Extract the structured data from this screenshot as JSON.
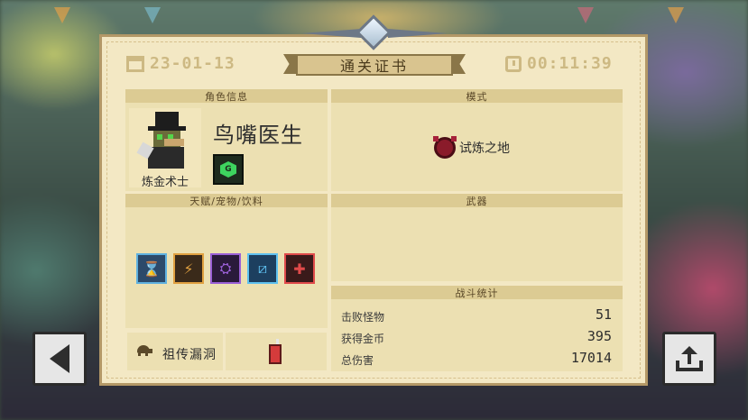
{
  "header": {
    "date": "23-01-13",
    "title": "通关证书",
    "time": "00:11:39"
  },
  "sections": {
    "character_info": "角色信息",
    "mode": "模式",
    "talents_pets_drinks": "天赋/宠物/饮料",
    "weapons": "武器",
    "battle_stats": "战斗统计"
  },
  "character": {
    "name": "鸟嘴医生",
    "class": "炼金术士",
    "skill_icon": "green-hex-skill-icon"
  },
  "mode": {
    "label": "试炼之地",
    "icon": "red-horned-mask-icon"
  },
  "talents": [
    {
      "icon": "hourglass-icon",
      "glyph": "⌛",
      "bg": "#2c4a6a",
      "border": "#5fb1e0"
    },
    {
      "icon": "lightning-bolts-icon",
      "glyph": "⚡",
      "bg": "#3a2a1a",
      "border": "#e0a040"
    },
    {
      "icon": "purple-wizard-hat-icon",
      "glyph": "⛭",
      "bg": "#2a1a3a",
      "border": "#9a5fd6"
    },
    {
      "icon": "blue-diagonal-stripe-icon",
      "glyph": "⧄",
      "bg": "#1d3f5f",
      "border": "#5fc1f0"
    },
    {
      "icon": "red-heart-plus-icon",
      "glyph": "✚",
      "bg": "#3a1a1a",
      "border": "#e04a4a"
    }
  ],
  "pet": {
    "name": "祖传漏洞",
    "icon": "turtle-icon"
  },
  "drink": {
    "icon": "red-soda-cup-icon"
  },
  "stats": [
    {
      "label": "击败怪物",
      "value": "51"
    },
    {
      "label": "获得金币",
      "value": "395"
    },
    {
      "label": "总伤害",
      "value": "17014"
    }
  ],
  "buttons": {
    "back_icon": "back-arrow-icon",
    "share_icon": "share-icon"
  },
  "colors": {
    "panel_bg": "#f3e8c4",
    "section_bg": "#ece0b2",
    "section_header": "#dccb93",
    "ribbon": "#d9c48f",
    "muted_text": "#cdb983"
  }
}
